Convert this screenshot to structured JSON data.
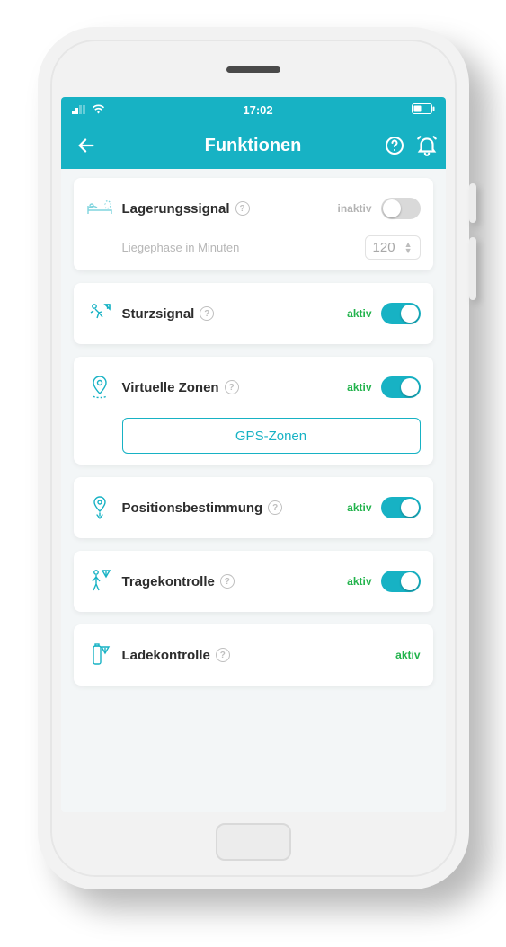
{
  "statusbar": {
    "time": "17:02"
  },
  "header": {
    "title": "Funktionen"
  },
  "labels": {
    "active": "aktiv",
    "inactive": "inaktiv"
  },
  "features": {
    "lagerung": {
      "title": "Lagerungssignal",
      "sub": "Liegephase in Minuten",
      "value": "120",
      "active": false
    },
    "sturz": {
      "title": "Sturzsignal",
      "active": true
    },
    "zonen": {
      "title": "Virtuelle Zonen",
      "button": "GPS-Zonen",
      "active": true
    },
    "position": {
      "title": "Positionsbestimmung",
      "active": true
    },
    "trage": {
      "title": "Tragekontrolle",
      "active": true
    },
    "lade": {
      "title": "Ladekontrolle",
      "active": true
    }
  }
}
